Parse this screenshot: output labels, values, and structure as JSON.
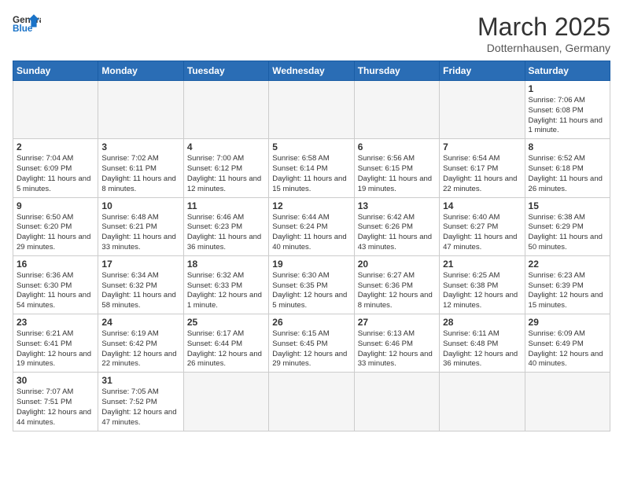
{
  "logo": {
    "text_general": "General",
    "text_blue": "Blue"
  },
  "title": "March 2025",
  "location": "Dotternhausen, Germany",
  "days_of_week": [
    "Sunday",
    "Monday",
    "Tuesday",
    "Wednesday",
    "Thursday",
    "Friday",
    "Saturday"
  ],
  "weeks": [
    [
      {
        "day": "",
        "info": ""
      },
      {
        "day": "",
        "info": ""
      },
      {
        "day": "",
        "info": ""
      },
      {
        "day": "",
        "info": ""
      },
      {
        "day": "",
        "info": ""
      },
      {
        "day": "",
        "info": ""
      },
      {
        "day": "1",
        "info": "Sunrise: 7:06 AM\nSunset: 6:08 PM\nDaylight: 11 hours and 1 minute."
      }
    ],
    [
      {
        "day": "2",
        "info": "Sunrise: 7:04 AM\nSunset: 6:09 PM\nDaylight: 11 hours and 5 minutes."
      },
      {
        "day": "3",
        "info": "Sunrise: 7:02 AM\nSunset: 6:11 PM\nDaylight: 11 hours and 8 minutes."
      },
      {
        "day": "4",
        "info": "Sunrise: 7:00 AM\nSunset: 6:12 PM\nDaylight: 11 hours and 12 minutes."
      },
      {
        "day": "5",
        "info": "Sunrise: 6:58 AM\nSunset: 6:14 PM\nDaylight: 11 hours and 15 minutes."
      },
      {
        "day": "6",
        "info": "Sunrise: 6:56 AM\nSunset: 6:15 PM\nDaylight: 11 hours and 19 minutes."
      },
      {
        "day": "7",
        "info": "Sunrise: 6:54 AM\nSunset: 6:17 PM\nDaylight: 11 hours and 22 minutes."
      },
      {
        "day": "8",
        "info": "Sunrise: 6:52 AM\nSunset: 6:18 PM\nDaylight: 11 hours and 26 minutes."
      }
    ],
    [
      {
        "day": "9",
        "info": "Sunrise: 6:50 AM\nSunset: 6:20 PM\nDaylight: 11 hours and 29 minutes."
      },
      {
        "day": "10",
        "info": "Sunrise: 6:48 AM\nSunset: 6:21 PM\nDaylight: 11 hours and 33 minutes."
      },
      {
        "day": "11",
        "info": "Sunrise: 6:46 AM\nSunset: 6:23 PM\nDaylight: 11 hours and 36 minutes."
      },
      {
        "day": "12",
        "info": "Sunrise: 6:44 AM\nSunset: 6:24 PM\nDaylight: 11 hours and 40 minutes."
      },
      {
        "day": "13",
        "info": "Sunrise: 6:42 AM\nSunset: 6:26 PM\nDaylight: 11 hours and 43 minutes."
      },
      {
        "day": "14",
        "info": "Sunrise: 6:40 AM\nSunset: 6:27 PM\nDaylight: 11 hours and 47 minutes."
      },
      {
        "day": "15",
        "info": "Sunrise: 6:38 AM\nSunset: 6:29 PM\nDaylight: 11 hours and 50 minutes."
      }
    ],
    [
      {
        "day": "16",
        "info": "Sunrise: 6:36 AM\nSunset: 6:30 PM\nDaylight: 11 hours and 54 minutes."
      },
      {
        "day": "17",
        "info": "Sunrise: 6:34 AM\nSunset: 6:32 PM\nDaylight: 11 hours and 58 minutes."
      },
      {
        "day": "18",
        "info": "Sunrise: 6:32 AM\nSunset: 6:33 PM\nDaylight: 12 hours and 1 minute."
      },
      {
        "day": "19",
        "info": "Sunrise: 6:30 AM\nSunset: 6:35 PM\nDaylight: 12 hours and 5 minutes."
      },
      {
        "day": "20",
        "info": "Sunrise: 6:27 AM\nSunset: 6:36 PM\nDaylight: 12 hours and 8 minutes."
      },
      {
        "day": "21",
        "info": "Sunrise: 6:25 AM\nSunset: 6:38 PM\nDaylight: 12 hours and 12 minutes."
      },
      {
        "day": "22",
        "info": "Sunrise: 6:23 AM\nSunset: 6:39 PM\nDaylight: 12 hours and 15 minutes."
      }
    ],
    [
      {
        "day": "23",
        "info": "Sunrise: 6:21 AM\nSunset: 6:41 PM\nDaylight: 12 hours and 19 minutes."
      },
      {
        "day": "24",
        "info": "Sunrise: 6:19 AM\nSunset: 6:42 PM\nDaylight: 12 hours and 22 minutes."
      },
      {
        "day": "25",
        "info": "Sunrise: 6:17 AM\nSunset: 6:44 PM\nDaylight: 12 hours and 26 minutes."
      },
      {
        "day": "26",
        "info": "Sunrise: 6:15 AM\nSunset: 6:45 PM\nDaylight: 12 hours and 29 minutes."
      },
      {
        "day": "27",
        "info": "Sunrise: 6:13 AM\nSunset: 6:46 PM\nDaylight: 12 hours and 33 minutes."
      },
      {
        "day": "28",
        "info": "Sunrise: 6:11 AM\nSunset: 6:48 PM\nDaylight: 12 hours and 36 minutes."
      },
      {
        "day": "29",
        "info": "Sunrise: 6:09 AM\nSunset: 6:49 PM\nDaylight: 12 hours and 40 minutes."
      }
    ],
    [
      {
        "day": "30",
        "info": "Sunrise: 7:07 AM\nSunset: 7:51 PM\nDaylight: 12 hours and 44 minutes."
      },
      {
        "day": "31",
        "info": "Sunrise: 7:05 AM\nSunset: 7:52 PM\nDaylight: 12 hours and 47 minutes."
      },
      {
        "day": "",
        "info": ""
      },
      {
        "day": "",
        "info": ""
      },
      {
        "day": "",
        "info": ""
      },
      {
        "day": "",
        "info": ""
      },
      {
        "day": "",
        "info": ""
      }
    ]
  ]
}
